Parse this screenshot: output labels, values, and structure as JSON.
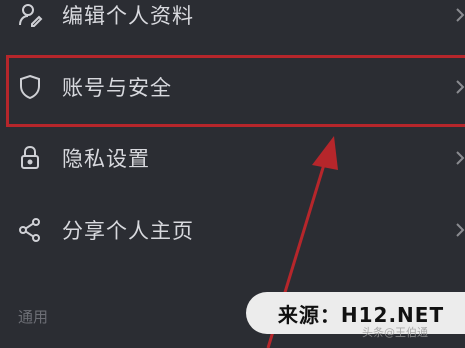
{
  "menu": {
    "items": [
      {
        "label": "编辑个人资料",
        "icon": "edit-profile-icon"
      },
      {
        "label": "账号与安全",
        "icon": "shield-icon"
      },
      {
        "label": "隐私设置",
        "icon": "lock-icon"
      },
      {
        "label": "分享个人主页",
        "icon": "share-icon"
      }
    ],
    "section_label": "通用"
  },
  "annotation": {
    "highlight_color": "#b6262b",
    "target": "账号与安全"
  },
  "watermark": {
    "text": "来源：H12.NET",
    "faint_text": "头条@王伯通"
  },
  "colors": {
    "background": "#2b2d33",
    "text": "#d8d9de",
    "muted": "#6c6e75"
  }
}
